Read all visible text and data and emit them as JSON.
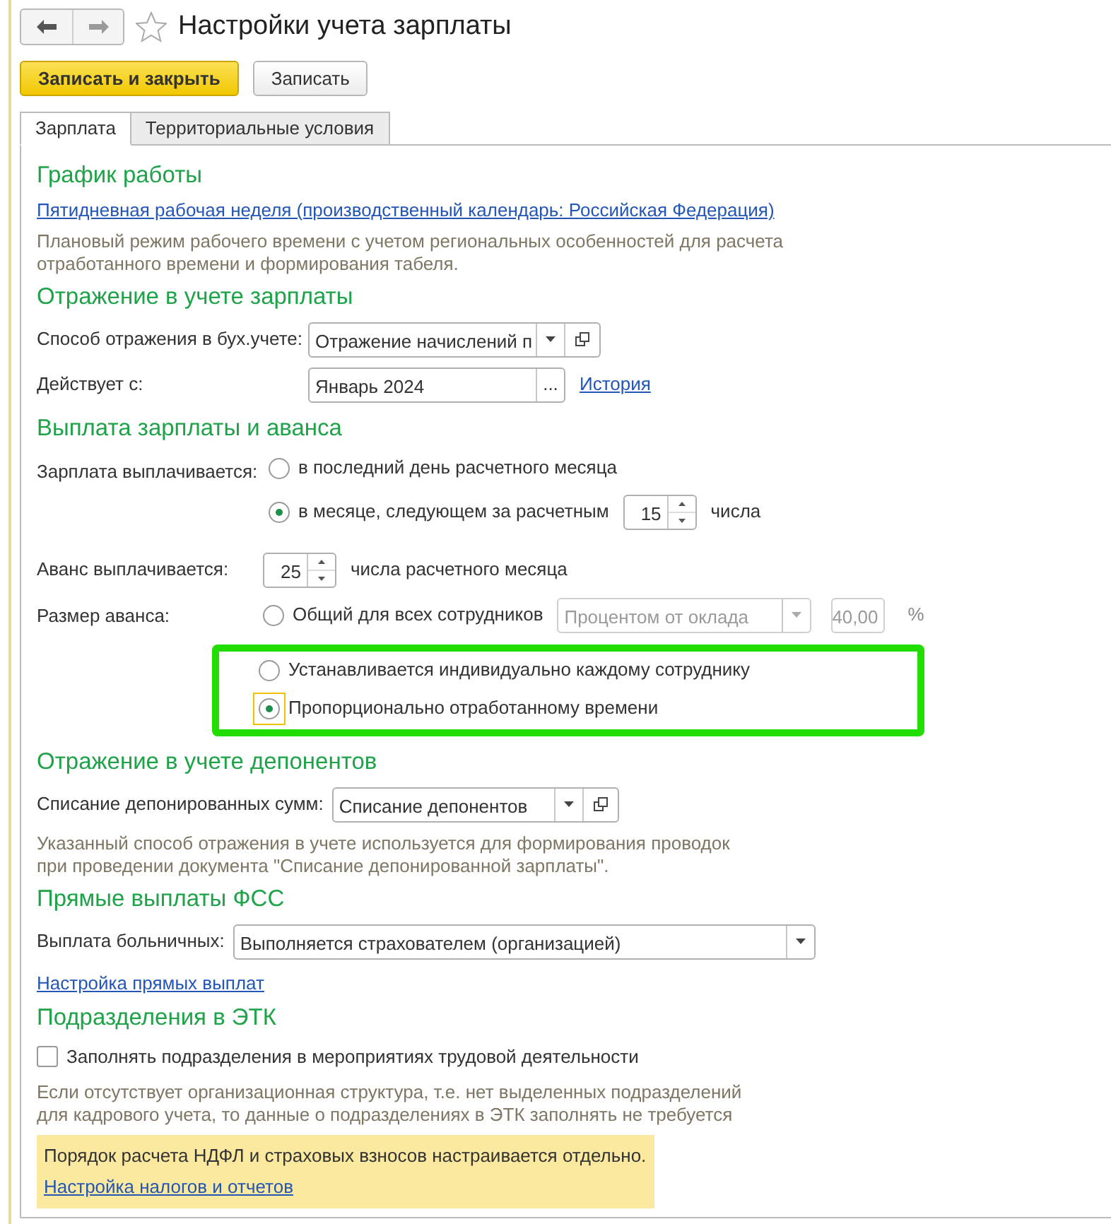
{
  "window": {
    "title": "Настройки учета зарплаты",
    "favorite": false
  },
  "toolbar": [
    {
      "label": "Записать и закрыть",
      "kind": "primary"
    },
    {
      "label": "Записать",
      "kind": "default"
    }
  ],
  "tabs": [
    {
      "label": "Зарплата",
      "selected": true
    },
    {
      "label": "Территориальные условия",
      "selected": false
    }
  ],
  "sections": [
    {
      "title": "График работы",
      "items": [
        {
          "kind": "link",
          "text": "Пятидневная рабочая неделя (производственный календарь: Российская Федерация)"
        },
        {
          "kind": "note",
          "lines": [
            "Плановый режим рабочего времени с учетом региональных особенностей для расчета",
            "отработанного времени и формирования табеля."
          ]
        }
      ]
    },
    {
      "title": "Отражение в учете зарплаты",
      "items": [
        {
          "kind": "combo",
          "label": "Способ отражения в бух.учете:",
          "value": "Отражение начислений п",
          "open_button": true
        },
        {
          "kind": "period",
          "label": "Действует с:",
          "value": "Январь 2024",
          "choose": "...",
          "link": "История"
        }
      ]
    },
    {
      "title": "Выплата зарплаты и аванса",
      "items": [
        {
          "kind": "radio",
          "label": "Зарплата выплачивается:",
          "options": [
            {
              "text": "в последний день расчетного месяца",
              "selected": false
            },
            {
              "text": "в месяце, следующем за расчетным",
              "selected": true,
              "spin": "15",
              "suffix": "числа"
            }
          ]
        },
        {
          "kind": "spin",
          "label": "Аванс выплачивается:",
          "value": "25",
          "suffix": "числа расчетного месяца"
        },
        {
          "kind": "radio",
          "label": "Размер аванса:",
          "options": [
            {
              "text": "Общий для всех сотрудников",
              "selected": false,
              "select": {
                "value": "Процентом от оклада",
                "disabled": true
              },
              "number": "40,00",
              "unit": "%"
            },
            {
              "text": "Устанавливается индивидуально каждому сотруднику",
              "selected": false,
              "highlighted": true
            },
            {
              "text": "Пропорционально отработанному времени",
              "selected": true,
              "focused": true,
              "highlighted": true
            }
          ]
        }
      ]
    },
    {
      "title": "Отражение в учете депонентов",
      "items": [
        {
          "kind": "combo",
          "label": "Списание депонированных сумм:",
          "value": "Списание депонентов",
          "open_button": true
        },
        {
          "kind": "note",
          "lines": [
            "Указанный способ отражения в учете используется для формирования проводок",
            "при проведении документа \"Списание депонированной зарплаты\"."
          ]
        }
      ]
    },
    {
      "title": "Прямые выплаты ФСС",
      "items": [
        {
          "kind": "combo",
          "label": "Выплата больничных:",
          "value": "Выполняется страхователем (организацией)",
          "open_button": false
        },
        {
          "kind": "link",
          "text": "Настройка прямых выплат"
        }
      ]
    },
    {
      "title": "Подразделения в ЭТК",
      "items": [
        {
          "kind": "checkbox",
          "text": "Заполнять подразделения в мероприятиях трудовой деятельности",
          "checked": false
        },
        {
          "kind": "note",
          "lines": [
            "Если отсутствует организационная структура, т.е. нет выделенных подразделений",
            "для кадрового учета, то данные о подразделениях в ЭТК заполнять не требуется"
          ]
        },
        {
          "kind": "info",
          "text": "Порядок расчета НДФЛ и страховых взносов настраивается отдельно.",
          "link": "Настройка налогов и отчетов"
        }
      ]
    }
  ]
}
